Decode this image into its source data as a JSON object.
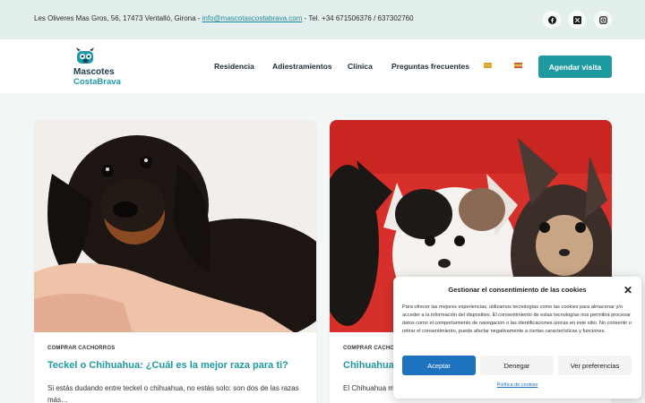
{
  "topbar": {
    "address": "Les Oliveres Mas Gros, 56, 17473 Ventalló, Girona - ",
    "email": "info@mascotascostabrava.com",
    "phone": " - Tel. +34 671506376 / 637302760",
    "social": [
      "facebook-icon",
      "x-icon",
      "instagram-icon"
    ]
  },
  "logo": {
    "line1": "Mascotes",
    "line2": "CostaBrava"
  },
  "nav": {
    "items": [
      "Residencia",
      "Adiestramientos",
      "Clínica",
      "Preguntas frecuentes"
    ],
    "cta": "Agendar visita"
  },
  "posts": [
    {
      "category": "COMPRAR CACHORROS",
      "title": "Teckel o Chihuahua: ¿Cuál es la mejor raza para ti?",
      "excerpt": "Si estás dudando entre teckel o chihuahua, no estás solo: son dos de las razas más…"
    },
    {
      "category": "COMPRAR CACHORROS",
      "title": "Chihuahua mini: Cuidados y cría en Catalunya",
      "excerpt": "El Chihuahua miniatura es la raza de perro más pequeña del mundo y una de"
    }
  ],
  "consent": {
    "title": "Gestionar el consentimiento de las cookies",
    "body": "Para ofrecer las mejores experiencias, utilizamos tecnologías como las cookies para almacenar y/o acceder a la información del dispositivo. El consentimiento de estas tecnologías nos permitirá procesar datos como el comportamiento de navegación o las identificaciones únicas en este sitio. No consentir o retirar el consentimiento, puede afectar negativamente a ciertas características y funciones.",
    "accept": "Aceptar",
    "deny": "Denegar",
    "prefs": "Ver preferencias",
    "policy": "Política de cookies"
  },
  "colors": {
    "accent": "#1f9aa0",
    "consent_accept": "#1e73be"
  }
}
